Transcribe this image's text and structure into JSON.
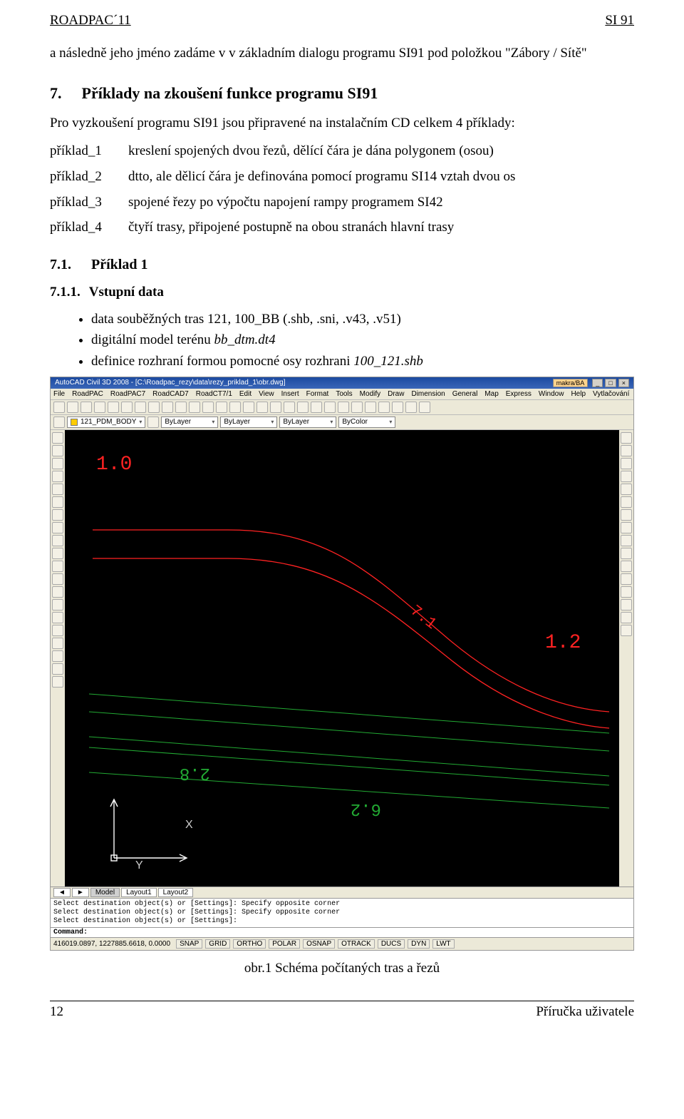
{
  "header": {
    "left": "ROADPAC´11",
    "right": "SI 91"
  },
  "intro": "a následně jeho jméno zadáme v v základním dialogu programu SI91 pod položkou \"Zábory / Sítě\"",
  "section": {
    "num": "7.",
    "title": "Příklady na zkoušení funkce programu SI91",
    "desc": "Pro vyzkoušení programu SI91 jsou připravené na instalačním CD celkem 4 příklady:"
  },
  "examples": [
    {
      "k": "příklad_1",
      "v": "kreslení spojených dvou řezů, dělící čára je dána polygonem (osou)"
    },
    {
      "k": "příklad_2",
      "v": "dtto, ale dělicí čára je definována pomocí programu SI14 vztah dvou os"
    },
    {
      "k": "příklad_3",
      "v": "spojené řezy po výpočtu napojení rampy programem SI42"
    },
    {
      "k": "příklad_4",
      "v": "čtyří trasy, připojené postupně na obou stranách hlavní trasy"
    }
  ],
  "sub1": {
    "num": "7.1.",
    "title": "Příklad 1"
  },
  "sub2": {
    "num": "7.1.1.",
    "title": "Vstupní data"
  },
  "bullets": [
    {
      "pre": "data souběžných tras 121, 100_BB (.shb, .sni, .v43, .v51)",
      "it": ""
    },
    {
      "pre": "digitální model terénu ",
      "it": "bb_dtm.dt4"
    },
    {
      "pre": "definice rozhraní formou pomocné osy rozhrani ",
      "it": "100_121.shb"
    }
  ],
  "cad": {
    "title": "AutoCAD Civil 3D 2008 - [C:\\Roadpac_rezy\\data\\rezy_priklad_1\\obr.dwg]",
    "badge": "makra/BA",
    "menu": [
      "File",
      "RoadPAC",
      "RoadPAC7",
      "RoadCAD7",
      "RoadCT7/1",
      "Edit",
      "View",
      "Insert",
      "Format",
      "Tools",
      "Modify",
      "Draw",
      "Dimension",
      "General",
      "Map",
      "Express",
      "Window",
      "Help",
      "Vytlačování"
    ],
    "layer": "121_PDM_BODY",
    "bylayer": "ByLayer",
    "tabs": {
      "nav": [
        "◄",
        "►"
      ],
      "items": [
        "Model",
        "Layout1",
        "Layout2"
      ]
    },
    "log": [
      "Select destination object(s) or [Settings]: Specify opposite corner",
      "Select destination object(s) or [Settings]: Specify opposite corner",
      "Select destination object(s) or [Settings]:"
    ],
    "cmd_label": "Command:",
    "coords": "416019.0897, 1227885.6618, 0.0000",
    "status_buttons": [
      "SNAP",
      "GRID",
      "ORTHO",
      "POLAR",
      "OSNAP",
      "OTRACK",
      "DUCS",
      "DYN",
      "LWT"
    ]
  },
  "caption": "obr.1 Schéma počítaných tras a řezů",
  "footer": {
    "left": "12",
    "right": "Příručka uživatele"
  }
}
